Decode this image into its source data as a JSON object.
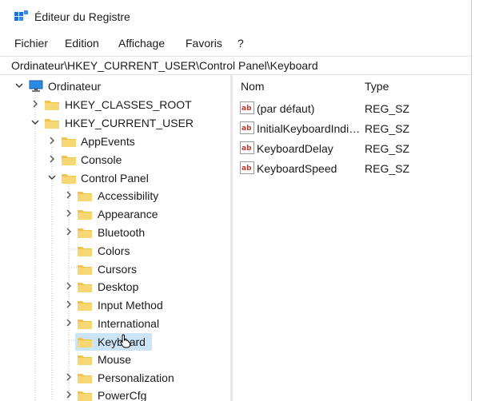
{
  "window": {
    "title": "Éditeur du Registre"
  },
  "menu": [
    "Fichier",
    "Edition",
    "Affichage",
    "Favoris",
    "?"
  ],
  "address": "Ordinateur\\HKEY_CURRENT_USER\\Control Panel\\Keyboard",
  "tree": {
    "root": "Ordinateur",
    "hkcr": "HKEY_CLASSES_ROOT",
    "hkcu": "HKEY_CURRENT_USER",
    "hkcu_children": [
      "AppEvents",
      "Console",
      "Control Panel"
    ],
    "control_panel_children": [
      "Accessibility",
      "Appearance",
      "Bluetooth",
      "Colors",
      "Cursors",
      "Desktop",
      "Input Method",
      "International",
      "Keyboard",
      "Mouse",
      "Personalization",
      "PowerCfg"
    ],
    "selected": "Keyboard"
  },
  "list": {
    "headers": {
      "name": "Nom",
      "type": "Type"
    },
    "rows": [
      {
        "name": "(par défaut)",
        "type": "REG_SZ"
      },
      {
        "name": "InitialKeyboardIndicators",
        "type": "REG_SZ"
      },
      {
        "name": "KeyboardDelay",
        "type": "REG_SZ"
      },
      {
        "name": "KeyboardSpeed",
        "type": "REG_SZ"
      }
    ]
  },
  "icons": {
    "app": "registry-editor-icon",
    "computer": "computer-icon",
    "folder": "folder-icon",
    "string_value": "string-value-icon"
  },
  "colors": {
    "selection": "#cce4f7",
    "folder": "#f0c24a",
    "accent": "#0078d7",
    "ab_red": "#c0392b"
  }
}
